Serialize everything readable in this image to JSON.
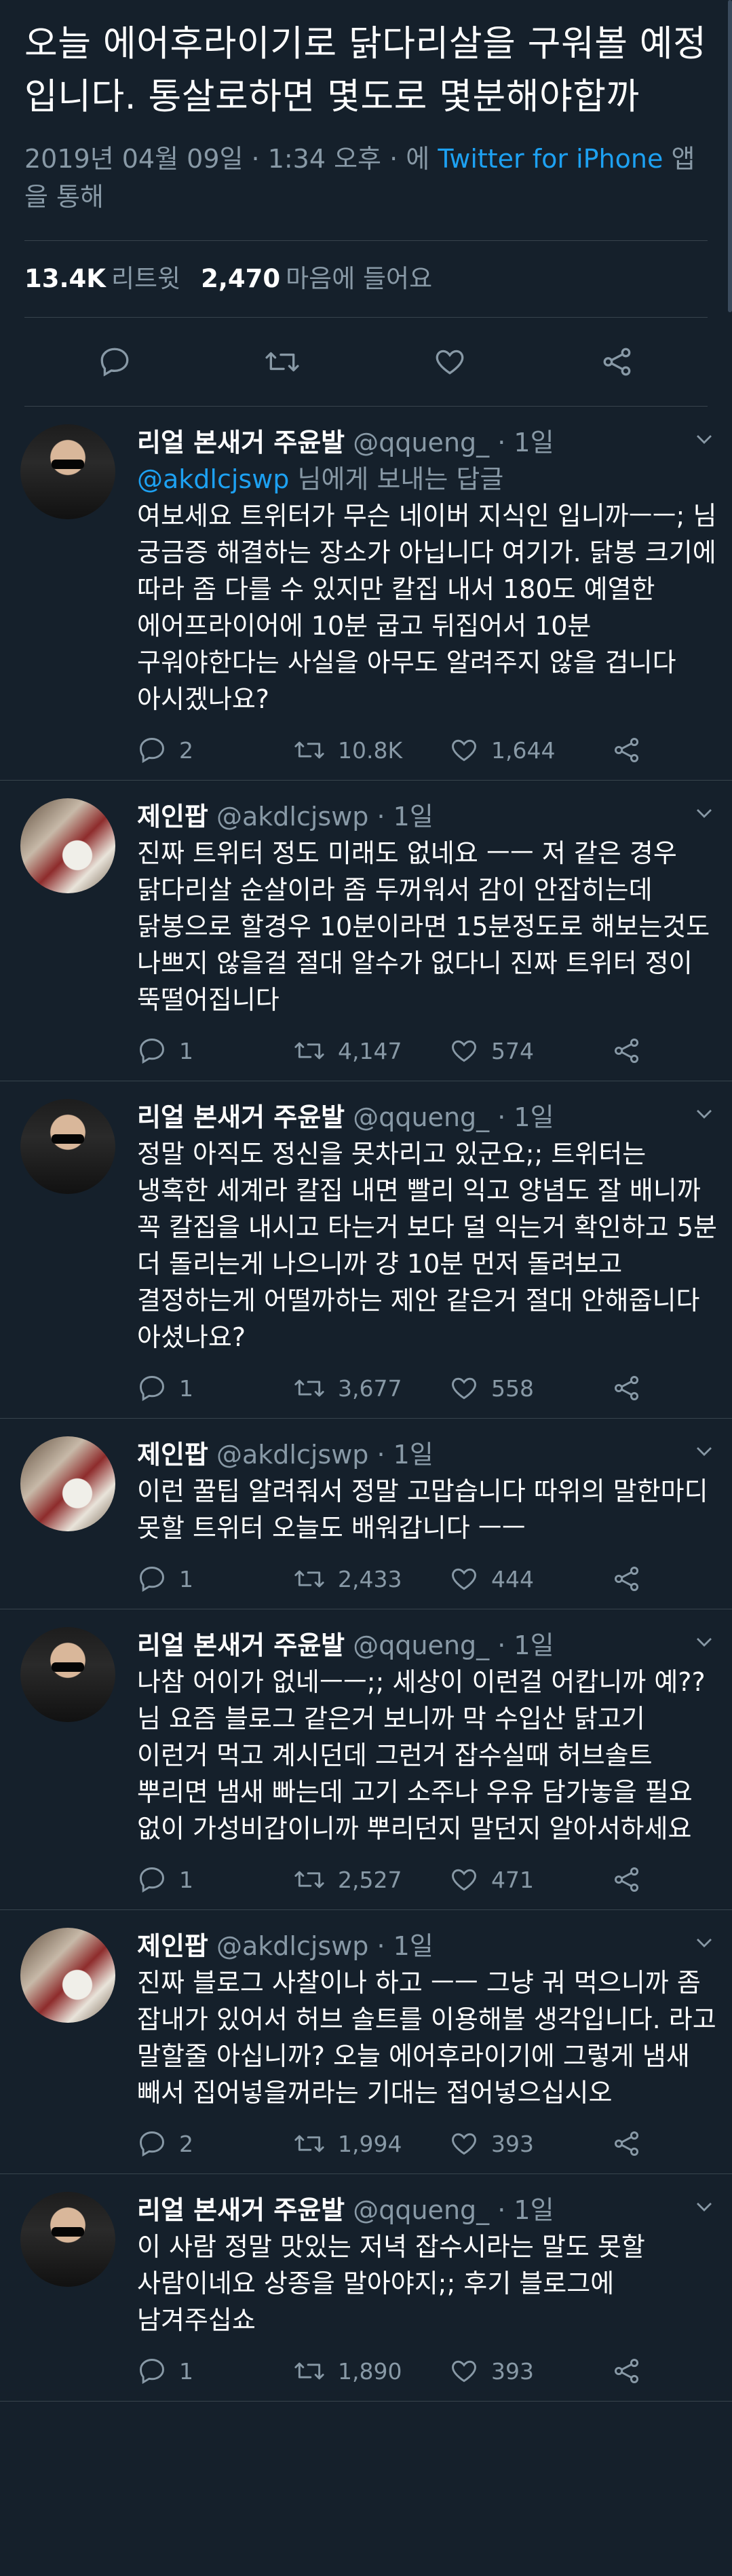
{
  "main_tweet": {
    "text": "오늘 에어후라이기로 닭다리살을 구워볼 예정입니다. 통살로하면 몇도로 몇분해야합까",
    "date": "2019년 04월 09일 · 1:34 오후 · 에 ",
    "source": "Twitter for iPhone",
    "source_suffix": " 앱을 통해",
    "retweets_count": "13.4K",
    "retweets_label": "리트윗",
    "likes_count": "2,470",
    "likes_label": "마음에 들어요"
  },
  "action_icons": [
    "reply-icon",
    "retweet-icon",
    "like-icon",
    "share-icon"
  ],
  "colors": {
    "background": "#15202b",
    "accent": "#1da1f2",
    "muted": "#8899a6",
    "divider": "#38444d"
  },
  "replies": [
    {
      "name": "리얼 본새거 주윤발",
      "handle": "@qqueng_",
      "time": "· 1일",
      "reply_prefix": "@akdlcjswp",
      "reply_suffix": " 님에게 보내는 답글",
      "text": "여보세요 트위터가 무슨 네이버 지식인 입니까ㅡㅡ; 님 궁금증 해결하는 장소가 아닙니다 여기가. 닭봉 크기에 따라 좀 다를 수 있지만 칼집 내서 180도 예열한 에어프라이어에 10분 굽고 뒤집어서 10분 구워야한다는 사실을 아무도 알려주지 않을 겁니다 아시겠나요?",
      "replies": "2",
      "retweets": "10.8K",
      "likes": "1,644"
    },
    {
      "name": "제인팝",
      "handle": "@akdlcjswp",
      "time": "· 1일",
      "text": "진짜 트위터 정도 미래도 없네요 ㅡㅡ 저 같은 경우 닭다리살 순살이라 좀 두꺼워서 감이 안잡히는데 닭봉으로 할경우 10분이라면 15분정도로 해보는것도 나쁘지 않을걸 절대 알수가 없다니 진짜 트위터 정이 뚝떨어집니다",
      "replies": "1",
      "retweets": "4,147",
      "likes": "574"
    },
    {
      "name": "리얼 본새거 주윤발",
      "handle": "@qqueng_",
      "time": "· 1일",
      "text": "정말 아직도 정신을 못차리고 있군요;; 트위터는 냉혹한 세계라 칼집 내면 빨리 익고 양념도 잘 배니까 꼭 칼집을 내시고 타는거 보다 덜 익는거 확인하고 5분 더 돌리는게 나으니까 걍 10분 먼저 돌려보고 결정하는게 어떨까하는 제안 같은거 절대 안해줍니다 아셨나요?",
      "replies": "1",
      "retweets": "3,677",
      "likes": "558"
    },
    {
      "name": "제인팝",
      "handle": "@akdlcjswp",
      "time": "· 1일",
      "text": "이런 꿀팁 알려줘서 정말 고맙습니다 따위의 말한마디 못할 트위터 오늘도 배워갑니다 ㅡㅡ",
      "replies": "1",
      "retweets": "2,433",
      "likes": "444"
    },
    {
      "name": "리얼 본새거 주윤발",
      "handle": "@qqueng_",
      "time": "· 1일",
      "text": "나참 어이가 없네ㅡㅡ;; 세상이 이런걸 어캅니까 예?? 님 요즘 블로그 같은거 보니까 막 수입산 닭고기 이런거 먹고 계시던데 그런거 잡수실때 허브솔트 뿌리면 냄새 빠는데 고기 소주나 우유 담가놓을 필요 없이 가성비갑이니까 뿌리던지 말던지 알아서하세요",
      "replies": "1",
      "retweets": "2,527",
      "likes": "471"
    },
    {
      "name": "제인팝",
      "handle": "@akdlcjswp",
      "time": "· 1일",
      "text": "진짜 블로그 사찰이나 하고 ㅡㅡ 그냥 궈 먹으니까 좀 잡내가 있어서 허브 솔트를 이용해볼 생각입니다. 라고 말할줄 아십니까? 오늘 에어후라이기에 그렇게 냄새 빼서 집어넣을꺼라는 기대는 접어넣으십시오",
      "replies": "2",
      "retweets": "1,994",
      "likes": "393"
    },
    {
      "name": "리얼 본새거 주윤발",
      "handle": "@qqueng_",
      "time": "· 1일",
      "text": "이 사람 정말 맛있는 저녁 잡수시라는 말도 못할 사람이네요 상종을 말아야지;; 후기 블로그에 남겨주십쇼",
      "replies": "1",
      "retweets": "1,890",
      "likes": "393"
    }
  ]
}
